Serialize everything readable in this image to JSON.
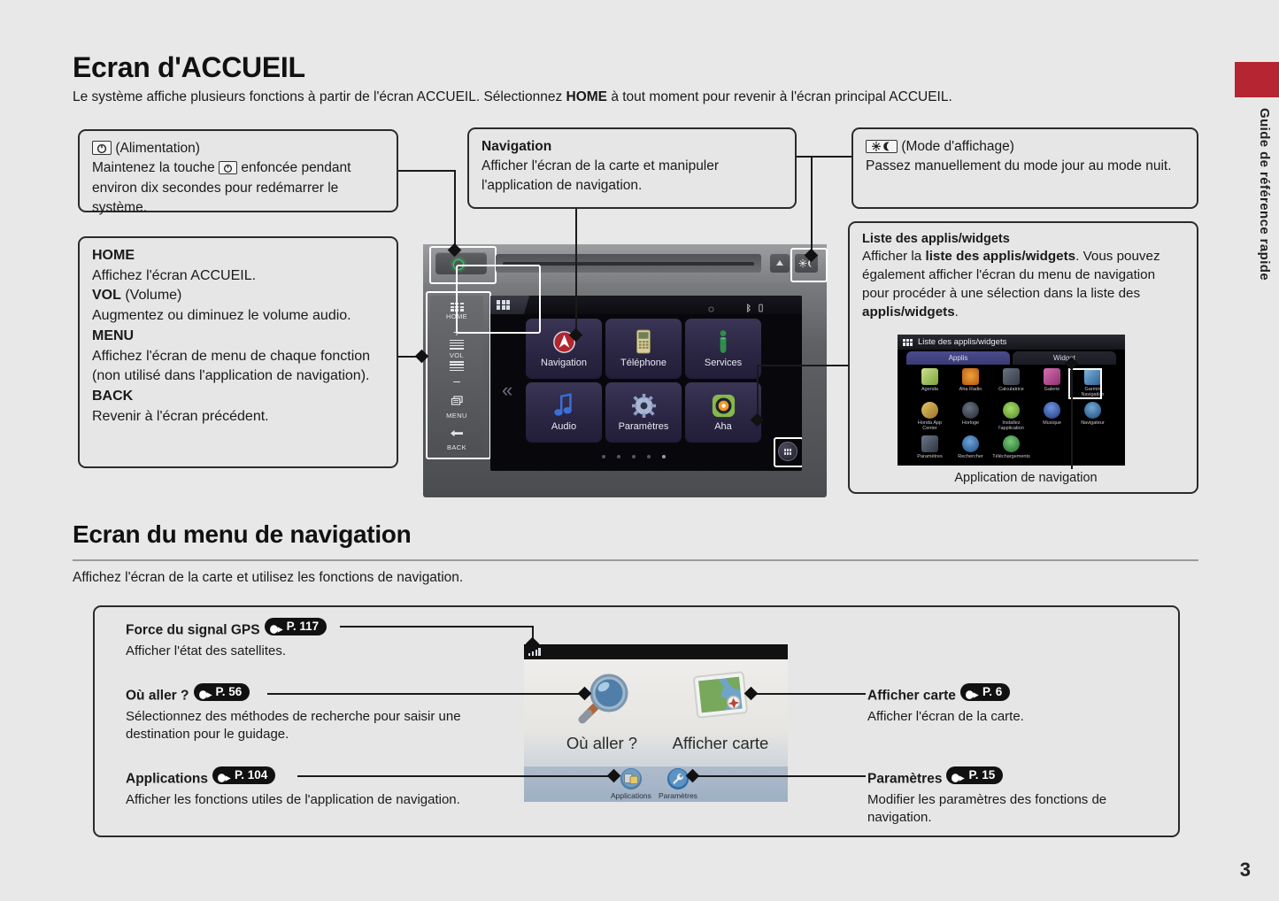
{
  "page": {
    "number": "3",
    "side_tab_text": "Guide de référence rapide",
    "accent_color": "#b52532"
  },
  "section_home": {
    "heading": "Ecran d'ACCUEIL",
    "intro_1": "Le système affiche plusieurs fonctions à partir de l'écran ACCUEIL. Sélectionnez ",
    "intro_bold": "HOME",
    "intro_2": " à tout moment pour revenir à l'écran principal ACCUEIL."
  },
  "callouts": {
    "power": {
      "title": "(Alimentation)",
      "line1_a": "Maintenez la touche",
      "line1_b": "enfoncée pendant",
      "line2": "environ dix secondes pour redémarrer le système."
    },
    "left_keys": {
      "home_title": "HOME",
      "home_desc": "Affichez l'écran ACCUEIL.",
      "vol_title": "VOL",
      "vol_title_note": "(Volume)",
      "vol_desc": "Augmentez ou diminuez le volume audio.",
      "menu_title": "MENU",
      "menu_desc": "Affichez l'écran de menu de chaque fonction (non utilisé dans l'application de navigation).",
      "back_title": "BACK",
      "back_desc": "Revenir à l'écran précédent."
    },
    "navigation": {
      "title": "Navigation",
      "desc": "Afficher l'écran de la carte et manipuler l'application de navigation."
    },
    "display_mode": {
      "title": "(Mode d'affichage)",
      "desc": "Passez manuellement du mode jour au mode nuit."
    },
    "apps_widgets": {
      "title": "Liste des applis/widgets",
      "desc_1": "Afficher la ",
      "desc_bold_1": "liste des applis/widgets",
      "desc_2": ". Vous pouvez également afficher l'écran du menu de navigation pour procéder à une sélection dans la liste des ",
      "desc_bold_2": "applis/widgets",
      "desc_3": ".",
      "caption": "Application de navigation"
    }
  },
  "head_unit": {
    "side_keys": [
      "HOME",
      "VOL",
      "MENU",
      "BACK"
    ],
    "apps": [
      {
        "label": "Navigation",
        "icon": "navigation-arrow-icon"
      },
      {
        "label": "Téléphone",
        "icon": "phone-icon"
      },
      {
        "label": "Services",
        "icon": "info-icon"
      },
      {
        "label": "Audio",
        "icon": "music-note-icon"
      },
      {
        "label": "Paramètres",
        "icon": "gear-icon"
      },
      {
        "label": "Aha",
        "icon": "aha-icon"
      }
    ],
    "page_dots": 5,
    "active_dot": 5
  },
  "apps_widgets_screen": {
    "title": "Liste des applis/widgets",
    "tabs": [
      {
        "label": "Applis",
        "selected": true
      },
      {
        "label": "Widget",
        "selected": false
      }
    ],
    "apps": [
      {
        "label": "Agenda",
        "color": "#8db84f"
      },
      {
        "label": "Aha Radio",
        "color": "#e2761b"
      },
      {
        "label": "Calculatrice",
        "color": "#4a5160"
      },
      {
        "label": "Galerie",
        "color": "#c0509a"
      },
      {
        "label": "Garmin Navigation",
        "color": "#3d7fc1"
      },
      {
        "label": "Honda App Center",
        "color": "#d2a23a"
      },
      {
        "label": "Horloge",
        "color": "#3b4450"
      },
      {
        "label": "Installez l'application",
        "color": "#7cba3d"
      },
      {
        "label": "Musique",
        "color": "#3a63b8"
      },
      {
        "label": "Navigateur",
        "color": "#2f6fa8"
      },
      {
        "label": "Paramètres",
        "color": "#49546a"
      },
      {
        "label": "Rechercher",
        "color": "#2f5d9e"
      },
      {
        "label": "Téléchargements",
        "color": "#3f8f4a"
      }
    ]
  },
  "section_navmenu": {
    "heading": "Ecran du menu de navigation",
    "intro": "Affichez l'écran de la carte et utilisez les fonctions de navigation."
  },
  "nav_callouts": {
    "gps": {
      "title": "Force du signal GPS",
      "page_ref": "P. 117",
      "desc": "Afficher l'état des satellites."
    },
    "where_to": {
      "title": "Où aller ?",
      "page_ref": "P. 56",
      "desc": "Sélectionnez des méthodes de recherche pour saisir une destination pour le guidage."
    },
    "applications": {
      "title": "Applications",
      "page_ref": "P. 104",
      "desc": "Afficher les fonctions utiles de l'application de navigation."
    },
    "view_map": {
      "title": "Afficher carte",
      "page_ref": "P. 6",
      "desc": "Afficher l'écran de la carte."
    },
    "settings": {
      "title": "Paramètres",
      "page_ref": "P. 15",
      "desc": "Modifier les paramètres des fonctions de navigation."
    }
  },
  "garmin_screen": {
    "where_to_label": "Où aller ?",
    "view_map_label": "Afficher carte",
    "applications_label": "Applications",
    "settings_label": "Paramètres"
  }
}
